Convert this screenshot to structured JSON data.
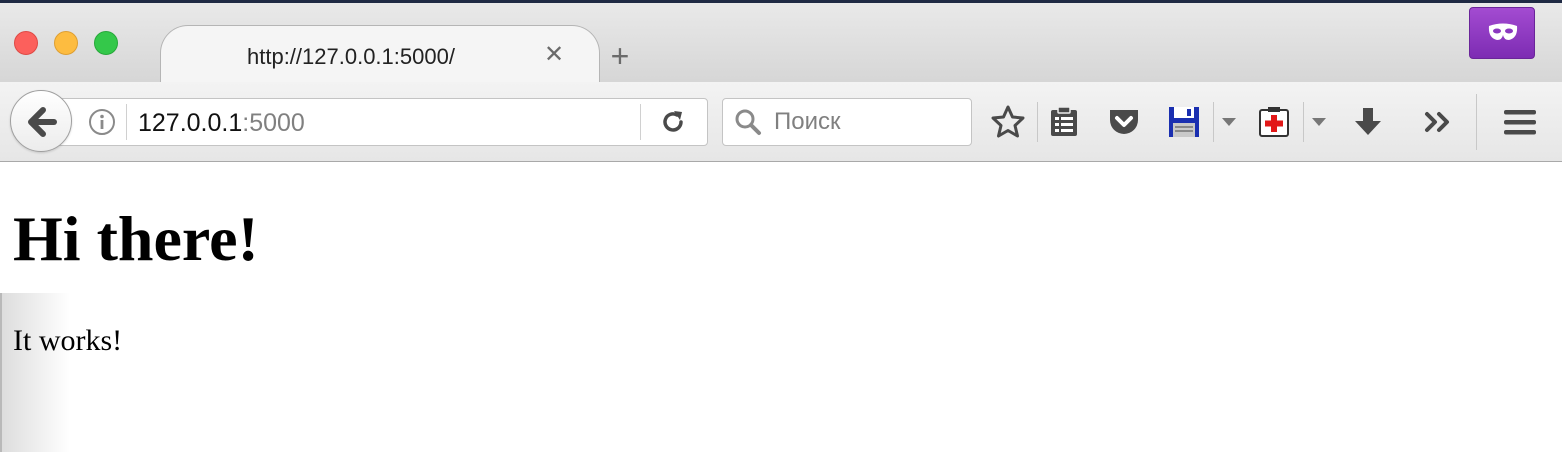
{
  "window": {
    "tab_title": "http://127.0.0.1:5000/",
    "tab_close_glyph": "✕",
    "new_tab_glyph": "+"
  },
  "toolbar": {
    "url_host": "127.0.0.1",
    "url_port": ":5000",
    "search_placeholder": "Поиск"
  },
  "icons": {
    "private_browsing": "mask-icon",
    "back": "arrow-left-icon",
    "site_info": "info-icon",
    "reload": "reload-icon",
    "search": "search-icon",
    "bookmark": "star-icon",
    "reading_list": "clipboard-icon",
    "pocket": "pocket-icon",
    "save_extension": "floppy-disk-icon",
    "addon_extension": "medical-cross-icon",
    "downloads": "download-arrow-icon",
    "overflow": "double-chevron-icon",
    "menu": "hamburger-menu-icon"
  },
  "colors": {
    "close_button": "#fc605c",
    "minimize_button": "#fdbc40",
    "maximize_button": "#34c84a",
    "private_browsing_badge": "#8b38c0"
  },
  "page": {
    "heading": "Hi there!",
    "paragraph": "It works!"
  }
}
